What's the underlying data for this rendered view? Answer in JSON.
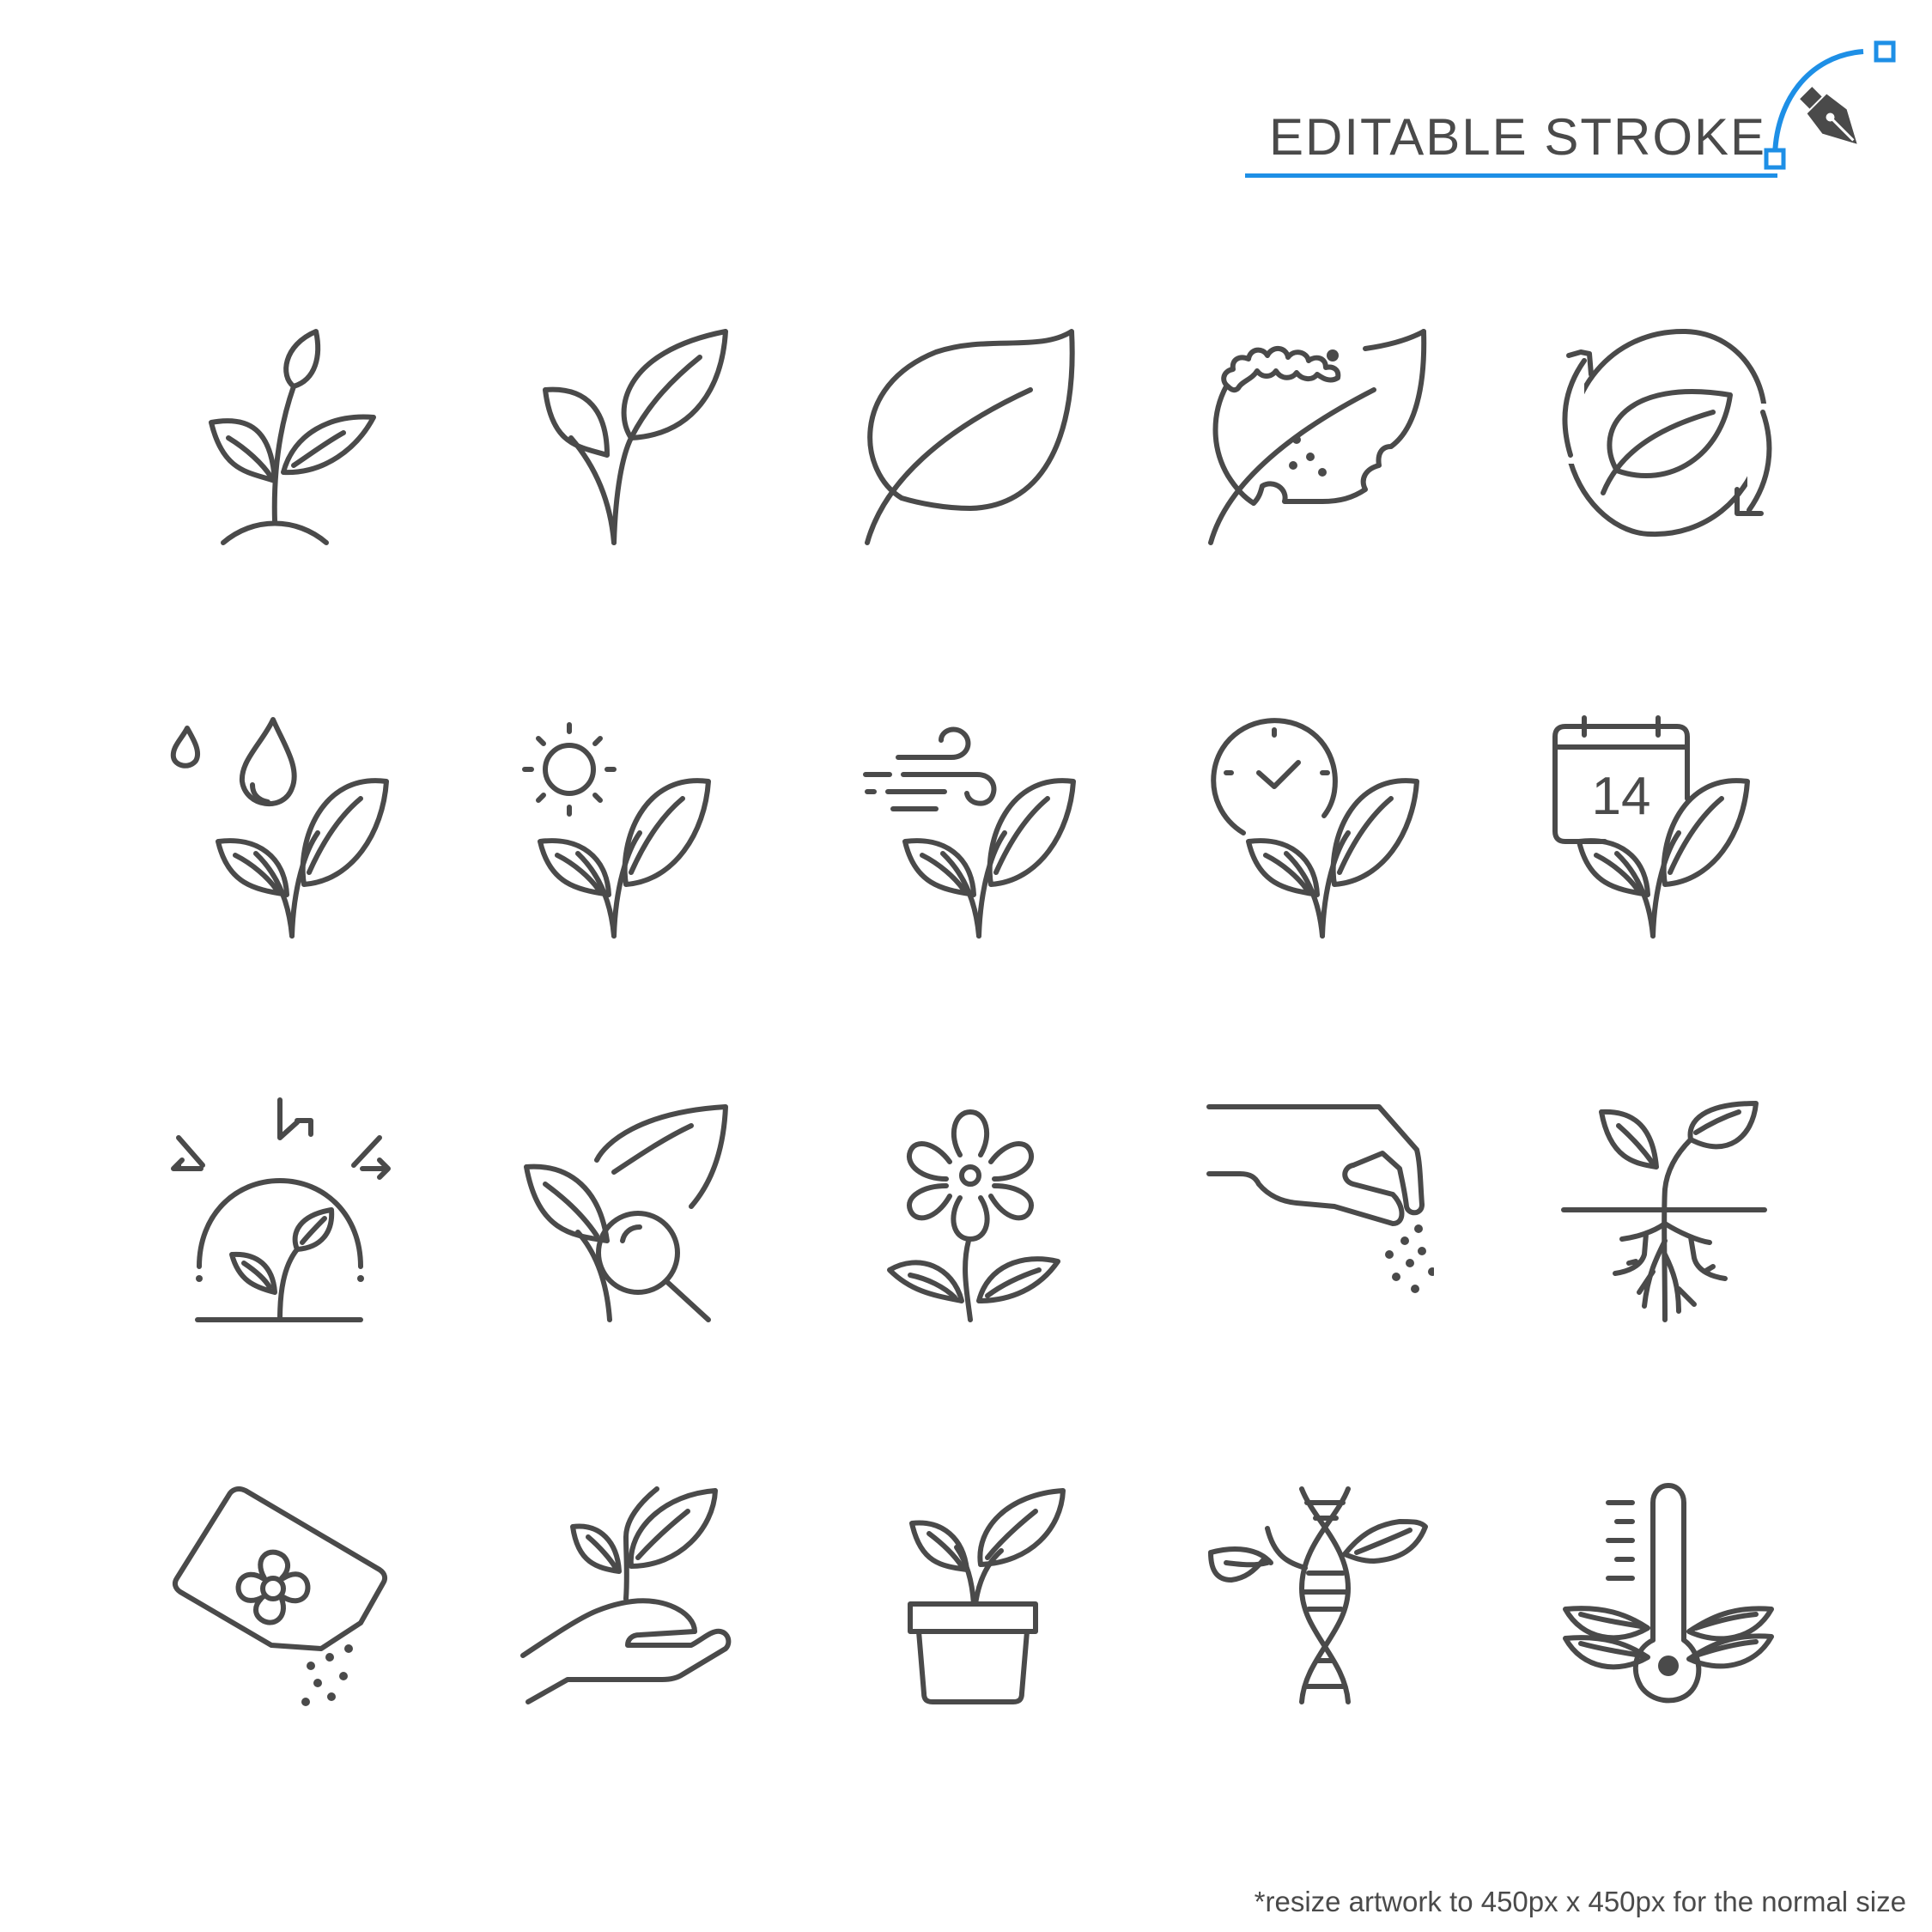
{
  "header": {
    "title": "EDITABLE STROKE",
    "accent_color": "#1e8fe6",
    "icon": "pen-tool-icon"
  },
  "icons": [
    {
      "name": "sprout-in-soil-icon"
    },
    {
      "name": "seedling-two-leaves-icon"
    },
    {
      "name": "single-leaf-icon"
    },
    {
      "name": "leaf-eaten-by-caterpillar-icon"
    },
    {
      "name": "leaf-recycle-icon"
    },
    {
      "name": "plant-watering-drops-icon"
    },
    {
      "name": "plant-sunlight-icon"
    },
    {
      "name": "plant-wind-icon"
    },
    {
      "name": "plant-growth-time-icon"
    },
    {
      "name": "plant-calendar-icon",
      "text": "14"
    },
    {
      "name": "plant-greenhouse-icon"
    },
    {
      "name": "plant-magnifier-inspect-icon"
    },
    {
      "name": "flower-icon"
    },
    {
      "name": "hand-sowing-seeds-icon"
    },
    {
      "name": "plant-roots-icon"
    },
    {
      "name": "seed-packet-icon"
    },
    {
      "name": "hand-holding-sprout-icon"
    },
    {
      "name": "potted-plant-icon"
    },
    {
      "name": "plant-dna-icon"
    },
    {
      "name": "plant-temperature-icon"
    }
  ],
  "footer": {
    "note": "*resize artwork to 450px x 450px for the normal size"
  },
  "colors": {
    "stroke": "#4a4a4a",
    "accent": "#1e8fe6",
    "background": "#ffffff"
  }
}
